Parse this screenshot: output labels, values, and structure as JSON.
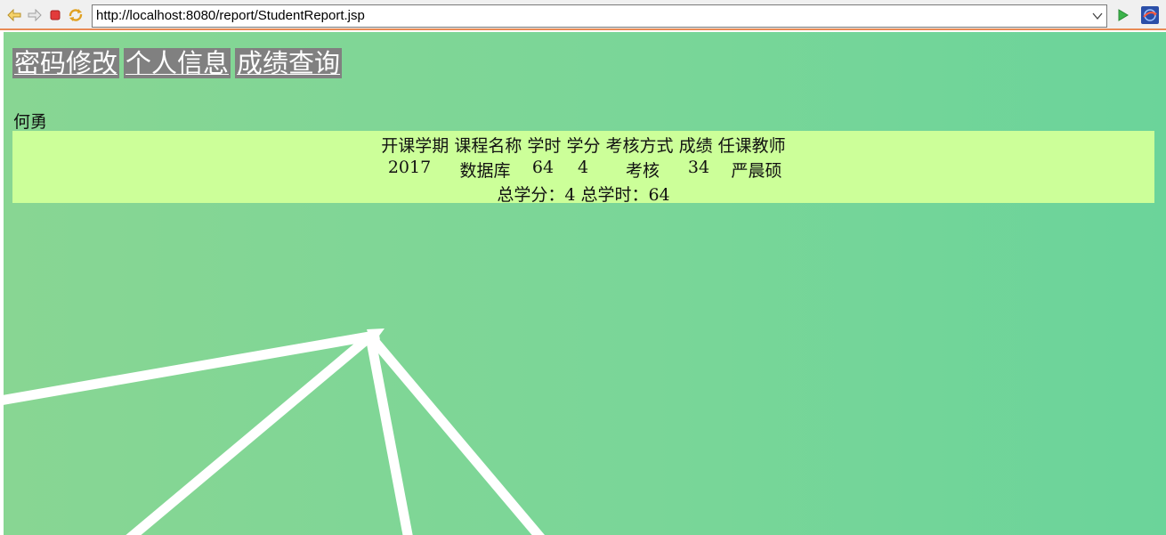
{
  "browser": {
    "url": "http://localhost:8080/report/StudentReport.jsp",
    "icons": {
      "back": "back-arrow-icon",
      "forward": "forward-arrow-icon",
      "stop": "stop-icon",
      "refresh": "refresh-icon",
      "dropdown": "chevron-down-icon",
      "go": "go-arrow-icon",
      "browser_logo": "browser-logo-icon"
    },
    "accent_color": "#e98b55"
  },
  "nav": {
    "items": [
      {
        "label": "密码修改"
      },
      {
        "label": "个人信息"
      },
      {
        "label": "成绩查询"
      }
    ]
  },
  "student": {
    "name": "何勇"
  },
  "report": {
    "headers": [
      "开课学期",
      "课程名称",
      "学时",
      "学分",
      "考核方式",
      "成绩",
      "任课教师"
    ],
    "rows": [
      [
        "2017",
        "数据库",
        "64",
        "4",
        "考核",
        "34",
        "严晨硕"
      ]
    ],
    "summary": "总学分：4 总学时：64"
  },
  "colors": {
    "nav_bg": "#808080",
    "table_bg": "#ccff99",
    "page_bg": "#7ad698"
  }
}
